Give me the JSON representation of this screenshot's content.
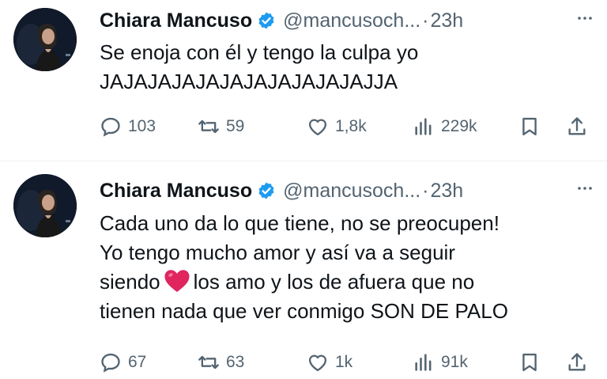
{
  "tweets": [
    {
      "author": {
        "name": "Chiara Mancuso",
        "handle": "@mancusoch...",
        "verified": true
      },
      "separator": "·",
      "time": "23h",
      "text_lines": [
        "Se enoja con él y tengo la culpa yo",
        "JAJAJAJAJAJAJAJAJAJAJAJJA"
      ],
      "stats": {
        "replies": "103",
        "reposts": "59",
        "likes": "1,8k",
        "views": "229k"
      }
    },
    {
      "author": {
        "name": "Chiara Mancuso",
        "handle": "@mancusoch...",
        "verified": true
      },
      "separator": "·",
      "time": "23h",
      "text_lines": [
        "Cada uno da lo que tiene, no se preocupen!",
        "Yo tengo mucho amor y así va a seguir",
        "siendo",
        "los amo y los de afuera que no",
        "tienen nada que ver conmigo SON DE PALO"
      ],
      "emoji": "red-heart",
      "stats": {
        "replies": "67",
        "reposts": "63",
        "likes": "1k",
        "views": "91k"
      }
    }
  ],
  "icons": [
    "verified-badge-icon",
    "more-icon",
    "reply-icon",
    "repost-icon",
    "like-icon",
    "views-icon",
    "bookmark-icon",
    "share-icon"
  ],
  "colors": {
    "text": "#0f1419",
    "secondary": "#536471",
    "verified": "#1d9bf0",
    "heart": "#e0245e"
  }
}
